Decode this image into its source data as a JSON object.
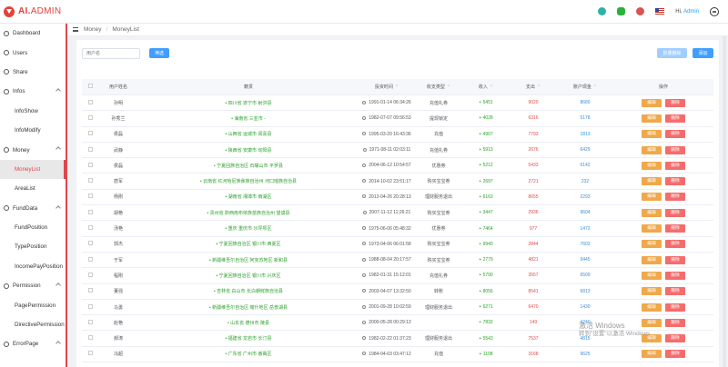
{
  "app": {
    "logo_ai": "AI.",
    "logo_admin": "ADMIN"
  },
  "topbar": {
    "greeting": "Hi,",
    "user": "Admin"
  },
  "breadcrumb": [
    "Money",
    "MoneyList"
  ],
  "sidebar": [
    {
      "label": "Dashboard",
      "sub": false
    },
    {
      "label": "Users",
      "sub": false
    },
    {
      "label": "Share",
      "sub": false
    },
    {
      "label": "Infos",
      "sub": false,
      "chev": true
    },
    {
      "label": "InfoShow",
      "sub": true
    },
    {
      "label": "InfoModify",
      "sub": true
    },
    {
      "label": "Money",
      "sub": false,
      "chev": true
    },
    {
      "label": "MoneyList",
      "sub": true,
      "active": true
    },
    {
      "label": "AreaList",
      "sub": true
    },
    {
      "label": "FundData",
      "sub": false,
      "chev": true
    },
    {
      "label": "FundPosition",
      "sub": true
    },
    {
      "label": "TypePosition",
      "sub": true
    },
    {
      "label": "IncomePayPosition",
      "sub": true
    },
    {
      "label": "Permission",
      "sub": false,
      "chev": true
    },
    {
      "label": "PagePermission",
      "sub": true
    },
    {
      "label": "DirectivePermission",
      "sub": true
    },
    {
      "label": "ErrorPage",
      "sub": false,
      "chev": true
    }
  ],
  "toolbar": {
    "filter_placeholder": "用户名",
    "filter_label": "筛选",
    "batch_label": "批量删除",
    "add_label": "添加"
  },
  "table": {
    "columns": [
      "用户姓名",
      "籍贯",
      "投资时间",
      "收支类型",
      "收入",
      "支出",
      "账户现金",
      "操作"
    ],
    "sort_marks": [
      "",
      "",
      "⌃",
      "⌃",
      "⌃",
      "⌃",
      "⌃",
      ""
    ],
    "edit_label": "编辑",
    "delete_label": "删除",
    "rows": [
      {
        "name": "孙明",
        "addr": "• 四川省 遂宁市 射洪县",
        "time": "1991-01-14 06:34:26",
        "type": "充值礼券",
        "in": "+ 5451",
        "out": "9020",
        "bal": "8680"
      },
      {
        "name": "孙秀兰",
        "addr": "• 海南省 三亚市 -",
        "time": "1982-07-07 09:56:53",
        "type": "提现锁定",
        "in": "+ 4028",
        "out": "6316",
        "bal": "5178"
      },
      {
        "name": "侯磊",
        "addr": "• 山西省 运城市 闻喜县",
        "time": "1995-03-20 16:43:36",
        "type": "充值",
        "in": "+ 4907",
        "out": "7793",
        "bal": "1813"
      },
      {
        "name": "武静",
        "addr": "• 陕西省 安康市 旬阳县",
        "time": "1971-08-11 02:03:11",
        "type": "充值礼券",
        "in": "+ 5913",
        "out": "2676",
        "bal": "6429"
      },
      {
        "name": "侯磊",
        "addr": "• 宁夏回族自治区 石嘴山市 平罗县",
        "time": "2004-06-12 10:54:57",
        "type": "优惠券",
        "in": "+ 5212",
        "out": "5433",
        "bal": "6142"
      },
      {
        "name": "唐军",
        "addr": "• 云南省 红河哈尼族彝族自治州 河口瑶族自治县",
        "time": "2014-10-02 23:51:17",
        "type": "购买宝宝券",
        "in": "+ 2697",
        "out": "2721",
        "bal": "232"
      },
      {
        "name": "杨刚",
        "addr": "• 湖南省 湘潭市 雨湖区",
        "time": "2012-04-26 20:28:13",
        "type": "理财服务退出",
        "in": "+ 6163",
        "out": "8655",
        "bal": "2293"
      },
      {
        "name": "胡艳",
        "addr": "• 贵州省 黔西南布依族苗族自治州 望谟县",
        "time": "2007-11-12 11:26:21",
        "type": "购买宝宝券",
        "in": "+ 3447",
        "out": "2936",
        "bal": "9604"
      },
      {
        "name": "汤艳",
        "addr": "• 重庆 重庆市 沙坪坝区",
        "time": "1975-06-06 05:48:32",
        "type": "优惠券",
        "in": "+ 7464",
        "out": "977",
        "bal": "1472"
      },
      {
        "name": "郭杰",
        "addr": "• 宁夏回族自治区 银川市 西夏区",
        "time": "1973-04-06 06:01:58",
        "type": "购买宝宝券",
        "in": "+ 9940",
        "out": "2844",
        "bal": "7602"
      },
      {
        "name": "于军",
        "addr": "• 新疆维吾尔自治区 阿克苏地区 新和县",
        "time": "1988-08-04 20:17:57",
        "type": "购买宝宝券",
        "in": "+ 2779",
        "out": "4821",
        "bal": "9445"
      },
      {
        "name": "程刚",
        "addr": "• 宁夏回族自治区 银川市 兴庆区",
        "time": "1982-01-31 15:12:01",
        "type": "充值礼券",
        "in": "+ 5790",
        "out": "3557",
        "bal": "6509"
      },
      {
        "name": "董强",
        "addr": "• 吉林省 白山市 长白朝鲜族自治县",
        "time": "2003-04-07 13:32:50",
        "type": "转账",
        "in": "+ 8056",
        "out": "8541",
        "bal": "6813"
      },
      {
        "name": "马勇",
        "addr": "• 新疆维吾尔自治区 喀什地区 岳普湖县",
        "time": "2001-09-28 10:02:59",
        "type": "理财服务退出",
        "in": "+ 6271",
        "out": "6470",
        "bal": "1430"
      },
      {
        "name": "赵艳",
        "addr": "• 山东省 德州市 陵县",
        "time": "2000-05-28 00:29:13",
        "type": "",
        "in": "+ 7832",
        "out": "149",
        "bal": "4240"
      },
      {
        "name": "郝涛",
        "addr": "• 福建省 龙岩市 长汀县",
        "time": "1982-02-22 01:37:23",
        "type": "理财服务退出",
        "in": "+ 5543",
        "out": "7537",
        "bal": "4815"
      },
      {
        "name": "冯超",
        "addr": "• 广东省 广州市 番禺区",
        "time": "1984-04-03 03:47:12",
        "type": "充值",
        "in": "+ 1108",
        "out": "3168",
        "bal": "9625"
      }
    ]
  },
  "watermark": {
    "line1": "激活 Windows",
    "line2": "转到\"设置\"以激活 Windows"
  }
}
